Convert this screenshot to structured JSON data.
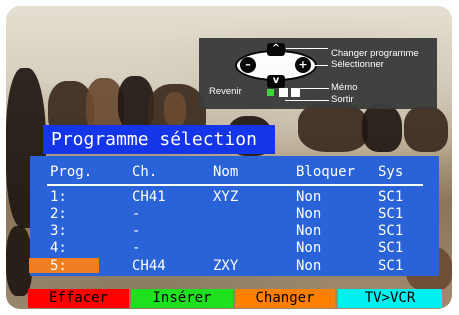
{
  "nav_panel": {
    "changer_programme": "Changer programme",
    "selectionner": "Sélectionner",
    "revenir": "Revenir",
    "memo": "Mémo",
    "sortir": "Sortir",
    "up_glyph": "^",
    "down_glyph": "v",
    "minus_glyph": "–",
    "plus_glyph": "+",
    "dot_colors": [
      "#3fd23f",
      "#ffffff",
      "#ffffff"
    ]
  },
  "menu": {
    "title": "Programme sélection",
    "headers": {
      "prog": "Prog.",
      "ch": "Ch.",
      "nom": "Nom",
      "bloquer": "Bloquer",
      "sys": "Sys"
    },
    "rows": [
      {
        "prog": "1:",
        "ch": "CH41",
        "nom": "XYZ",
        "bloquer": "Non",
        "sys": "SC1",
        "selected": false
      },
      {
        "prog": "2:",
        "ch": "-",
        "nom": "",
        "bloquer": "Non",
        "sys": "SC1",
        "selected": false
      },
      {
        "prog": "3:",
        "ch": "-",
        "nom": "",
        "bloquer": "Non",
        "sys": "SC1",
        "selected": false
      },
      {
        "prog": "4:",
        "ch": "-",
        "nom": "",
        "bloquer": "Non",
        "sys": "SC1",
        "selected": false
      },
      {
        "prog": "5:",
        "ch": "CH44",
        "nom": "ZXY",
        "bloquer": "Non",
        "sys": "SC1",
        "selected": true
      }
    ],
    "highlight_color": "#f07d20"
  },
  "function_bar": {
    "buttons": [
      {
        "label": "Effacer",
        "color": "#ff0000"
      },
      {
        "label": "Insérer",
        "color": "#1fe01f"
      },
      {
        "label": "Changer",
        "color": "#ff8000"
      },
      {
        "label": "TV>VCR",
        "color": "#00f0f0"
      }
    ]
  }
}
